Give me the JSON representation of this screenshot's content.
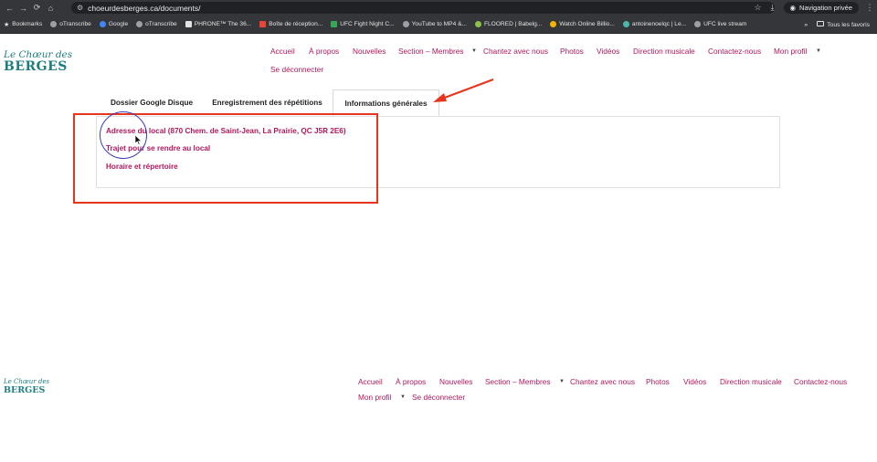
{
  "browser": {
    "url": "choeurdesberges.ca/documents/",
    "private_label": "Navigation privée",
    "nav_icons": [
      "back-icon",
      "forward-icon",
      "reload-icon",
      "home-icon"
    ],
    "bookmarks": [
      {
        "label": "Bookmarks",
        "color": "#e3e3e3"
      },
      {
        "label": "oTranscribe",
        "color": "#9aa0a6"
      },
      {
        "label": "Google",
        "color": "#4285f4"
      },
      {
        "label": "oTranscribe",
        "color": "#9aa0a6"
      },
      {
        "label": "PHRONE™ The 36...",
        "color": "#e3e3e3"
      },
      {
        "label": "Boîte de réception...",
        "color": "#ea4335"
      },
      {
        "label": "UFC Fight Night C...",
        "color": "#34a853"
      },
      {
        "label": "YouTube to MP4 &...",
        "color": "#9aa0a6"
      },
      {
        "label": "FLOORED | Babelg...",
        "color": "#8bc34a"
      },
      {
        "label": "Watch Online Billio...",
        "color": "#f4b400"
      },
      {
        "label": "antoinenoelqc | Le...",
        "color": "#4db6ac"
      },
      {
        "label": "UFC live stream",
        "color": "#9aa0a6"
      }
    ],
    "more_label": "»",
    "all_bookmarks_label": "Tous les favoris"
  },
  "site": {
    "logo_line1": "Le Chœur des",
    "logo_line2": "BERGES",
    "colors": {
      "accent": "#b0185c",
      "brand": "#1e7d80",
      "annotation": "#e8341c"
    },
    "menu": [
      {
        "label": "Accueil"
      },
      {
        "label": "À propos"
      },
      {
        "label": "Nouvelles"
      },
      {
        "label": "Section – Membres"
      },
      {
        "label": "Chantez avec nous"
      },
      {
        "label": "Photos"
      },
      {
        "label": "Vidéos"
      },
      {
        "label": "Direction musicale"
      },
      {
        "label": "Contactez-nous"
      },
      {
        "label": "Mon profil"
      },
      {
        "label": "Se déconnecter"
      }
    ]
  },
  "tabs": [
    {
      "label": "Dossier Google Disque",
      "active": false
    },
    {
      "label": "Enregistrement des répétitions",
      "active": false
    },
    {
      "label": "Informations générales",
      "active": true
    }
  ],
  "panel": {
    "links": [
      {
        "label": "Adresse du local (870 Chem. de Saint-Jean, La Prairie, QC J5R 2E6)"
      },
      {
        "label": "Trajet pour se rendre au local"
      },
      {
        "label": "Horaire et répertoire"
      }
    ]
  }
}
